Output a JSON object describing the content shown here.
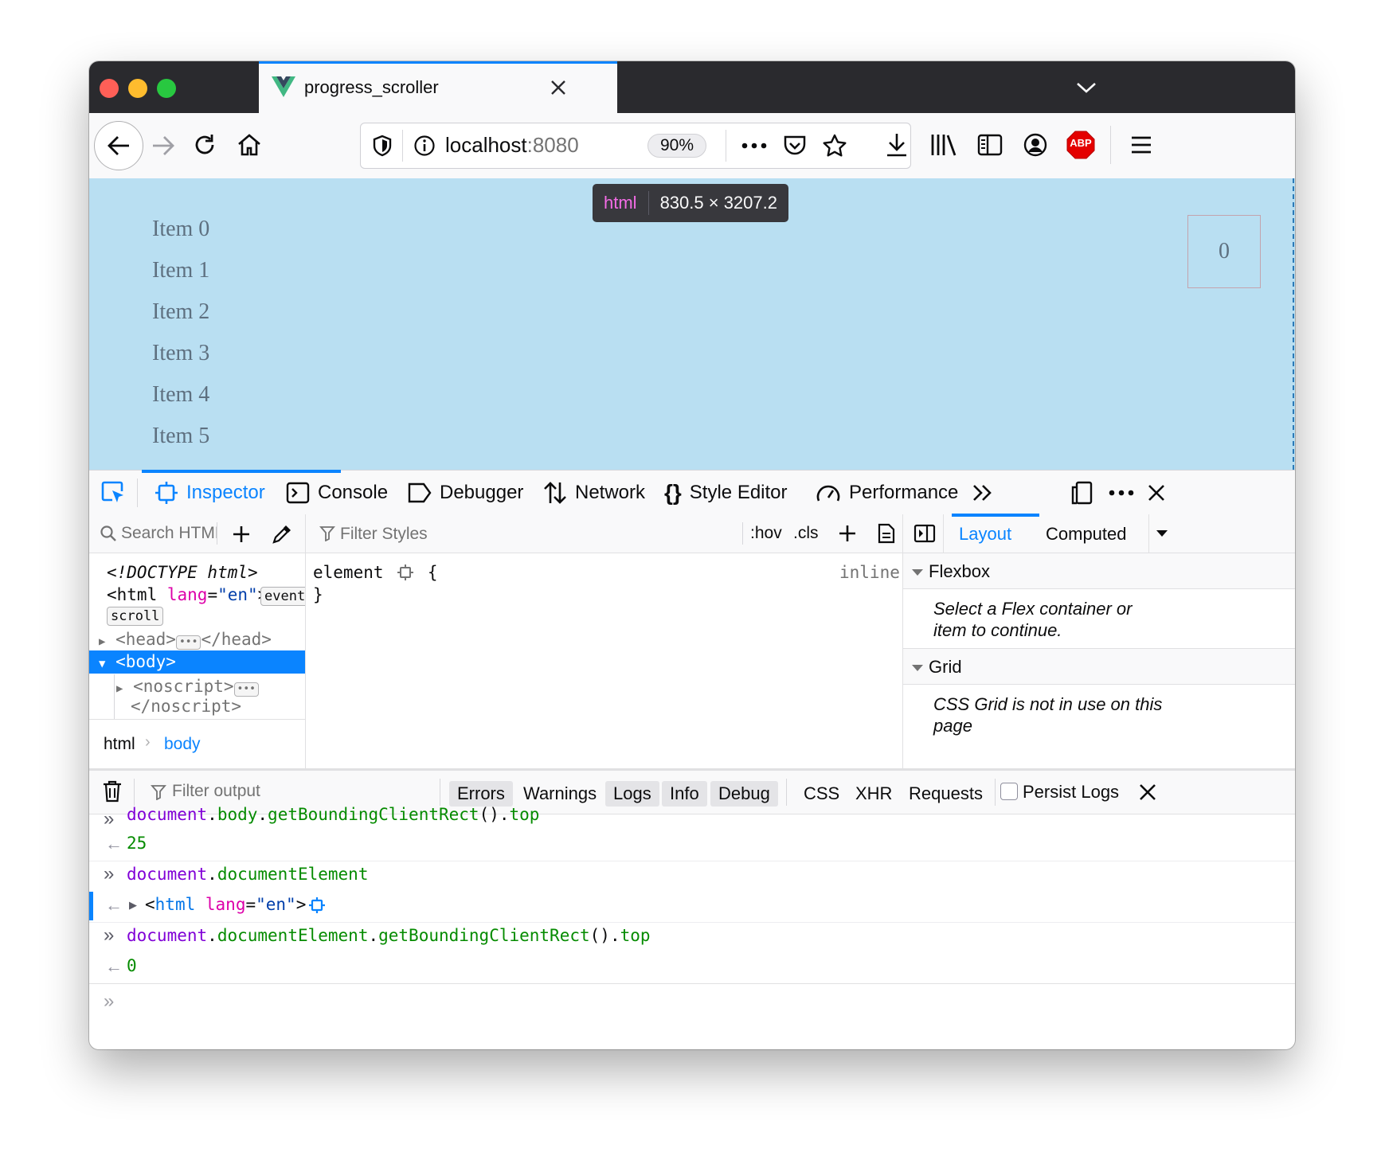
{
  "tab": {
    "title": "progress_scroller"
  },
  "url": {
    "host": "localhost",
    "port": ":8080",
    "zoom": "90%"
  },
  "toolbar_icons": [
    "back-icon",
    "forward-icon",
    "reload-icon",
    "home-icon",
    "shield-icon",
    "info-icon",
    "more-icon",
    "pocket-icon",
    "bookmark-star-icon",
    "download-icon",
    "library-icon",
    "sidebar-icon",
    "account-icon",
    "adblock-icon",
    "menu-icon"
  ],
  "adblock_label": "ABP",
  "page": {
    "tooltip_tag": "html",
    "tooltip_size": "830.5 × 3207.2",
    "items": [
      "Item 0",
      "Item 1",
      "Item 2",
      "Item 3",
      "Item 4",
      "Item 5"
    ],
    "progress_value": "0"
  },
  "devtools": {
    "tabs": [
      "Inspector",
      "Console",
      "Debugger",
      "Network",
      "Style Editor",
      "Performance"
    ],
    "markup": {
      "search_placeholder": "Search HTML",
      "doctype": "<!DOCTYPE html>",
      "html_open": "<html",
      "lang_attr": "lang",
      "lang_eq": "=",
      "lang_val": "\"en\"",
      "html_close": ">",
      "event_badge": "event",
      "scroll_badge": "scroll",
      "head_open": "<head>",
      "head_close": "</head>",
      "body": "<body>",
      "noscript_open": "<noscript>",
      "noscript_close": "</noscript>",
      "breadcrumb": [
        "html",
        "body"
      ]
    },
    "rules": {
      "filter_placeholder": "Filter Styles",
      "hov": ":hov",
      "cls": ".cls",
      "selector": "element",
      "open_brace": "{",
      "close_brace": "}",
      "source": "inline"
    },
    "layout": {
      "tabs": [
        "Layout",
        "Computed"
      ],
      "flexbox_title": "Flexbox",
      "flexbox_msg": "Select a Flex container or item to continue.",
      "grid_title": "Grid",
      "grid_msg": "CSS Grid is not in use on this page"
    },
    "console": {
      "filter_placeholder": "Filter output",
      "filters": [
        "Errors",
        "Warnings",
        "Logs",
        "Info",
        "Debug",
        "CSS",
        "XHR",
        "Requests"
      ],
      "persist_label": "Persist Logs",
      "entries": [
        {
          "input": [
            "document",
            ".",
            "body",
            ".",
            "getBoundingClientRect",
            "()",
            ".",
            "top"
          ],
          "output": "25"
        },
        {
          "input": [
            "document",
            ".",
            "documentElement"
          ],
          "output_html": [
            "<",
            "html",
            "lang",
            "=",
            "\"en\"",
            ">"
          ]
        },
        {
          "input": [
            "document",
            ".",
            "documentElement",
            ".",
            "getBoundingClientRect",
            "()",
            ".",
            "top"
          ],
          "output": "0"
        }
      ]
    }
  },
  "colors": {
    "accent": "#0a84ff",
    "highlight": "#b9dff2",
    "titlebar": "#2a2a2e"
  }
}
